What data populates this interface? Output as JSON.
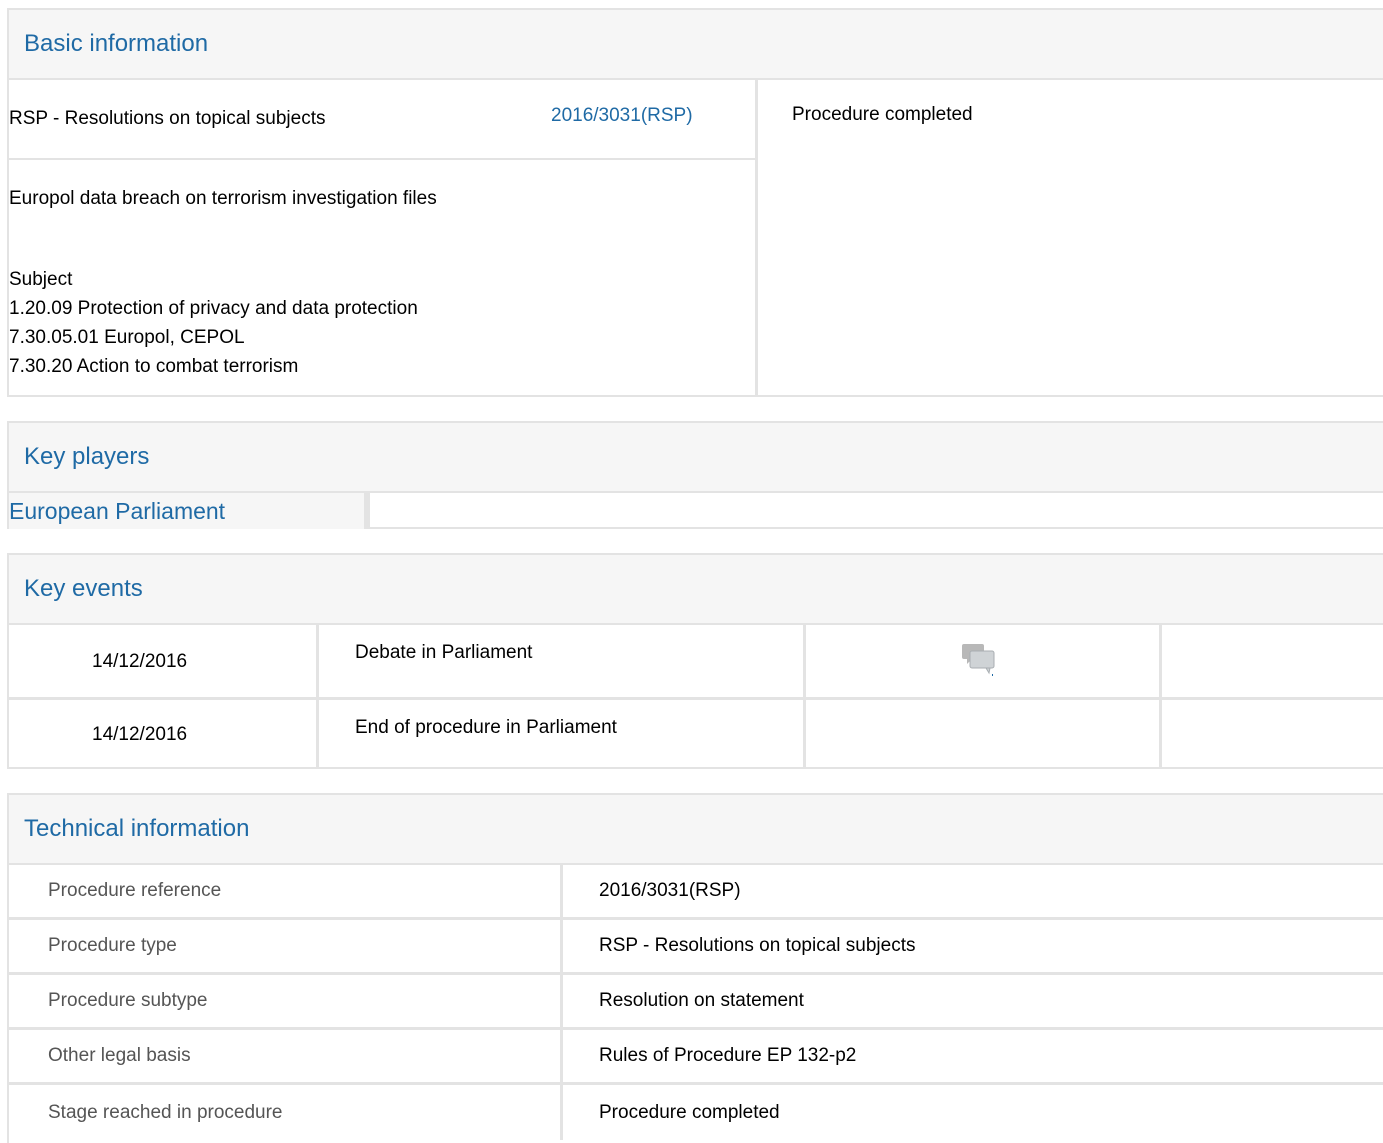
{
  "basic_information": {
    "heading": "Basic information",
    "procedure_type": "RSP - Resolutions on topical subjects",
    "procedure_reference": "2016/3031(RSP)",
    "status": "Procedure completed",
    "title": "Europol data breach on terrorism investigation files",
    "subject_heading": "Subject",
    "subjects": [
      "1.20.09 Protection of privacy and data protection",
      "7.30.05.01 Europol, CEPOL",
      "7.30.20 Action to combat terrorism"
    ]
  },
  "key_players": {
    "heading": "Key players",
    "institution": "European Parliament"
  },
  "key_events": {
    "heading": "Key events",
    "rows": [
      {
        "date": "14/12/2016",
        "event": "Debate in Parliament",
        "icon": "debate-icon"
      },
      {
        "date": "14/12/2016",
        "event": "End of procedure in Parliament"
      }
    ]
  },
  "technical_information": {
    "heading": "Technical information",
    "rows": [
      {
        "label": "Procedure reference",
        "value": "2016/3031(RSP)"
      },
      {
        "label": "Procedure type",
        "value": "RSP - Resolutions on topical subjects"
      },
      {
        "label": "Procedure subtype",
        "value": "Resolution on statement"
      },
      {
        "label": "Other legal basis",
        "value": "Rules of Procedure EP 132-p2"
      },
      {
        "label": "Stage reached in procedure",
        "value": "Procedure completed"
      }
    ]
  },
  "colors": {
    "link_blue": "#1f6aa5",
    "border_grey": "#e3e3e3",
    "header_bg": "#f6f6f6"
  }
}
